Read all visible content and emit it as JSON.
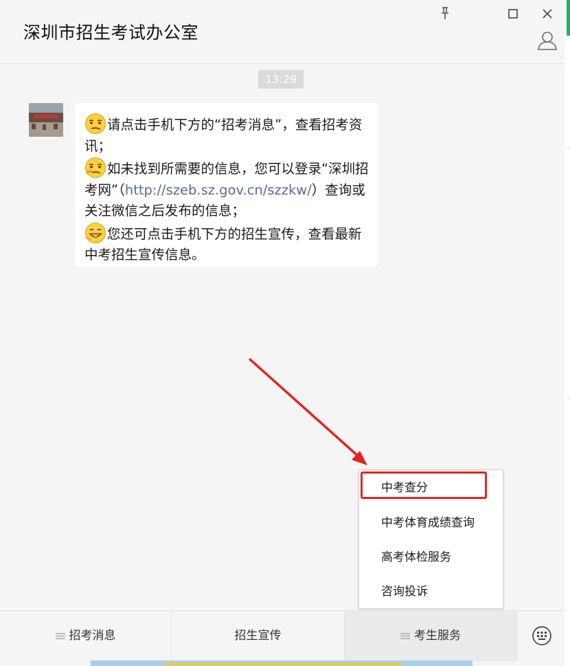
{
  "window": {
    "title": "深圳市招生考试办公室",
    "controls": [
      "pin-icon",
      "maximize-icon",
      "close-icon",
      "profile-icon"
    ]
  },
  "chat": {
    "timestamp": "13:29",
    "message": {
      "line1": "请点击手机下方的“招考消息”，查看招考资讯；",
      "line2_before_link": "如未找到所需要的信息，您可以登录“深圳招考网”（",
      "link": "http://szeb.sz.gov.cn/szzkw/",
      "line2_after_link": "）查询或关注微信之后发布的信息；",
      "line3": "您还可点击手机下方的招生宣传，查看最新中考招生宣传信息。"
    },
    "emojis": [
      "smirk-emoji-icon",
      "smirk-emoji-icon",
      "grin-emoji-icon"
    ]
  },
  "popup_menu": {
    "items": [
      {
        "label": "中考查分"
      },
      {
        "label": "中考体育成绩查询"
      },
      {
        "label": "高考体检服务"
      },
      {
        "label": "咨询投诉"
      }
    ],
    "highlighted_index": 0,
    "highlight_color": "#e8211e"
  },
  "bottom_menu": {
    "tabs": [
      {
        "label": "招考消息",
        "icon": "menu-lines-icon"
      },
      {
        "label": "招生宣传"
      },
      {
        "label": "考生服务",
        "icon": "menu-lines-icon"
      }
    ],
    "active_tab": 2,
    "keyboard_icon": "keyboard-icon"
  },
  "annotation": {
    "arrow_color": "#e8211e"
  }
}
